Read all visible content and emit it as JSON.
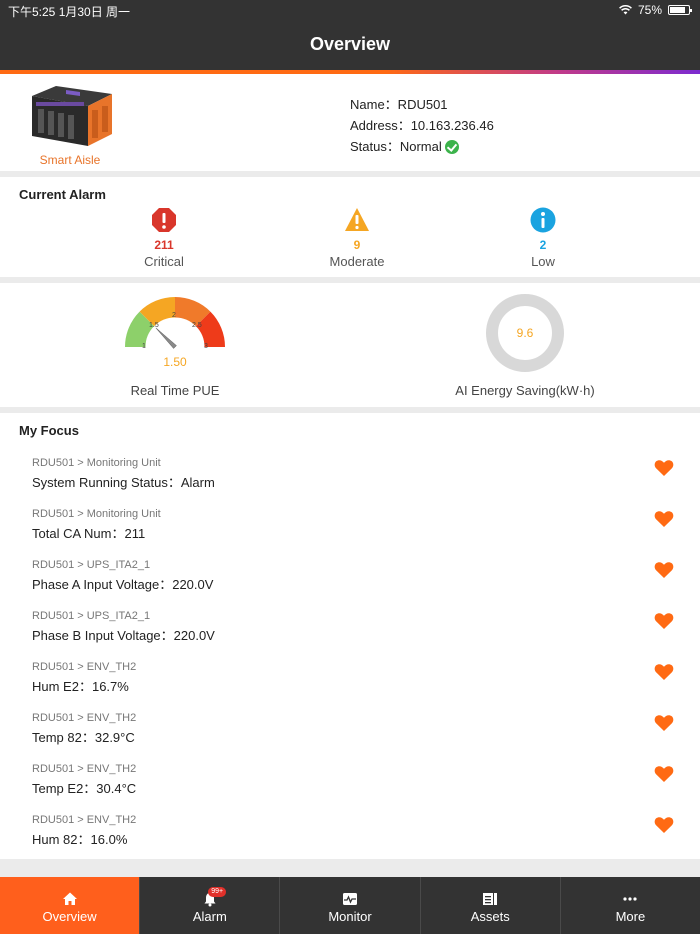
{
  "status_bar": {
    "time": "下午5:25  1月30日 周一",
    "battery": "75%",
    "battery_level": 0.75
  },
  "header": {
    "title": "Overview"
  },
  "device": {
    "image_label": "Smart Aisle",
    "name": "Name：RDU501",
    "address": "Address：10.163.236.46",
    "status": "Status：Normal"
  },
  "current_alarm": {
    "title": "Current Alarm",
    "items": [
      {
        "count": "211",
        "label": "Critical",
        "color": "#d9362b",
        "icon": "critical-alarm-icon"
      },
      {
        "count": "9",
        "label": "Moderate",
        "color": "#f5a623",
        "icon": "moderate-alarm-icon"
      },
      {
        "count": "2",
        "label": "Low",
        "color": "#1aa3e0",
        "icon": "low-alarm-icon"
      }
    ]
  },
  "pue": {
    "value": "1.50",
    "label": "Real Time PUE",
    "ticks": [
      "1",
      "1.5",
      "2",
      "2.5",
      "3"
    ],
    "min": 1,
    "max": 3,
    "current": 1.5
  },
  "energy": {
    "value": "9.6",
    "label": "AI Energy Saving(kW·h)"
  },
  "my_focus": {
    "title": "My Focus",
    "items": [
      {
        "path": "RDU501 > Monitoring Unit",
        "value": "System Running Status：Alarm"
      },
      {
        "path": "RDU501 > Monitoring Unit",
        "value": "Total CA Num：211"
      },
      {
        "path": "RDU501 > UPS_ITA2_1",
        "value": "Phase A Input Voltage：220.0V"
      },
      {
        "path": "RDU501 > UPS_ITA2_1",
        "value": "Phase B Input Voltage：220.0V"
      },
      {
        "path": "RDU501 > ENV_TH2",
        "value": "Hum E2：16.7%"
      },
      {
        "path": "RDU501 > ENV_TH2",
        "value": "Temp 82：32.9°C"
      },
      {
        "path": "RDU501 > ENV_TH2",
        "value": "Temp E2：30.4°C"
      },
      {
        "path": "RDU501 > ENV_TH2",
        "value": "Hum 82：16.0%"
      }
    ]
  },
  "tabs": [
    {
      "label": "Overview",
      "icon": "home-icon",
      "active": true
    },
    {
      "label": "Alarm",
      "icon": "bell-icon",
      "badge": "99+"
    },
    {
      "label": "Monitor",
      "icon": "monitor-icon"
    },
    {
      "label": "Assets",
      "icon": "assets-icon"
    },
    {
      "label": "More",
      "icon": "more-icon"
    }
  ],
  "colors": {
    "accent": "#ff5f1c",
    "bar": "#333333",
    "heart": "#ff6a13"
  }
}
